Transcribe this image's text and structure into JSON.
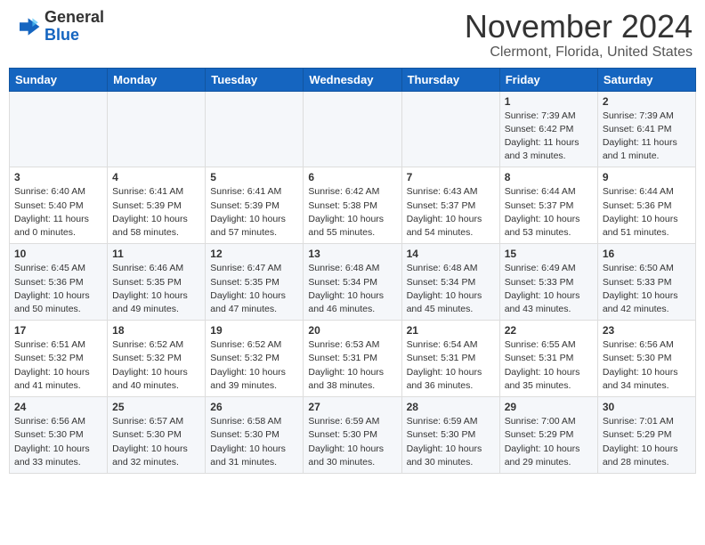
{
  "header": {
    "logo_line1": "General",
    "logo_line2": "Blue",
    "month": "November 2024",
    "location": "Clermont, Florida, United States"
  },
  "weekdays": [
    "Sunday",
    "Monday",
    "Tuesday",
    "Wednesday",
    "Thursday",
    "Friday",
    "Saturday"
  ],
  "weeks": [
    [
      {
        "day": "",
        "info": ""
      },
      {
        "day": "",
        "info": ""
      },
      {
        "day": "",
        "info": ""
      },
      {
        "day": "",
        "info": ""
      },
      {
        "day": "",
        "info": ""
      },
      {
        "day": "1",
        "info": "Sunrise: 7:39 AM\nSunset: 6:42 PM\nDaylight: 11 hours\nand 3 minutes."
      },
      {
        "day": "2",
        "info": "Sunrise: 7:39 AM\nSunset: 6:41 PM\nDaylight: 11 hours\nand 1 minute."
      }
    ],
    [
      {
        "day": "3",
        "info": "Sunrise: 6:40 AM\nSunset: 5:40 PM\nDaylight: 11 hours\nand 0 minutes."
      },
      {
        "day": "4",
        "info": "Sunrise: 6:41 AM\nSunset: 5:39 PM\nDaylight: 10 hours\nand 58 minutes."
      },
      {
        "day": "5",
        "info": "Sunrise: 6:41 AM\nSunset: 5:39 PM\nDaylight: 10 hours\nand 57 minutes."
      },
      {
        "day": "6",
        "info": "Sunrise: 6:42 AM\nSunset: 5:38 PM\nDaylight: 10 hours\nand 55 minutes."
      },
      {
        "day": "7",
        "info": "Sunrise: 6:43 AM\nSunset: 5:37 PM\nDaylight: 10 hours\nand 54 minutes."
      },
      {
        "day": "8",
        "info": "Sunrise: 6:44 AM\nSunset: 5:37 PM\nDaylight: 10 hours\nand 53 minutes."
      },
      {
        "day": "9",
        "info": "Sunrise: 6:44 AM\nSunset: 5:36 PM\nDaylight: 10 hours\nand 51 minutes."
      }
    ],
    [
      {
        "day": "10",
        "info": "Sunrise: 6:45 AM\nSunset: 5:36 PM\nDaylight: 10 hours\nand 50 minutes."
      },
      {
        "day": "11",
        "info": "Sunrise: 6:46 AM\nSunset: 5:35 PM\nDaylight: 10 hours\nand 49 minutes."
      },
      {
        "day": "12",
        "info": "Sunrise: 6:47 AM\nSunset: 5:35 PM\nDaylight: 10 hours\nand 47 minutes."
      },
      {
        "day": "13",
        "info": "Sunrise: 6:48 AM\nSunset: 5:34 PM\nDaylight: 10 hours\nand 46 minutes."
      },
      {
        "day": "14",
        "info": "Sunrise: 6:48 AM\nSunset: 5:34 PM\nDaylight: 10 hours\nand 45 minutes."
      },
      {
        "day": "15",
        "info": "Sunrise: 6:49 AM\nSunset: 5:33 PM\nDaylight: 10 hours\nand 43 minutes."
      },
      {
        "day": "16",
        "info": "Sunrise: 6:50 AM\nSunset: 5:33 PM\nDaylight: 10 hours\nand 42 minutes."
      }
    ],
    [
      {
        "day": "17",
        "info": "Sunrise: 6:51 AM\nSunset: 5:32 PM\nDaylight: 10 hours\nand 41 minutes."
      },
      {
        "day": "18",
        "info": "Sunrise: 6:52 AM\nSunset: 5:32 PM\nDaylight: 10 hours\nand 40 minutes."
      },
      {
        "day": "19",
        "info": "Sunrise: 6:52 AM\nSunset: 5:32 PM\nDaylight: 10 hours\nand 39 minutes."
      },
      {
        "day": "20",
        "info": "Sunrise: 6:53 AM\nSunset: 5:31 PM\nDaylight: 10 hours\nand 38 minutes."
      },
      {
        "day": "21",
        "info": "Sunrise: 6:54 AM\nSunset: 5:31 PM\nDaylight: 10 hours\nand 36 minutes."
      },
      {
        "day": "22",
        "info": "Sunrise: 6:55 AM\nSunset: 5:31 PM\nDaylight: 10 hours\nand 35 minutes."
      },
      {
        "day": "23",
        "info": "Sunrise: 6:56 AM\nSunset: 5:30 PM\nDaylight: 10 hours\nand 34 minutes."
      }
    ],
    [
      {
        "day": "24",
        "info": "Sunrise: 6:56 AM\nSunset: 5:30 PM\nDaylight: 10 hours\nand 33 minutes."
      },
      {
        "day": "25",
        "info": "Sunrise: 6:57 AM\nSunset: 5:30 PM\nDaylight: 10 hours\nand 32 minutes."
      },
      {
        "day": "26",
        "info": "Sunrise: 6:58 AM\nSunset: 5:30 PM\nDaylight: 10 hours\nand 31 minutes."
      },
      {
        "day": "27",
        "info": "Sunrise: 6:59 AM\nSunset: 5:30 PM\nDaylight: 10 hours\nand 30 minutes."
      },
      {
        "day": "28",
        "info": "Sunrise: 6:59 AM\nSunset: 5:30 PM\nDaylight: 10 hours\nand 30 minutes."
      },
      {
        "day": "29",
        "info": "Sunrise: 7:00 AM\nSunset: 5:29 PM\nDaylight: 10 hours\nand 29 minutes."
      },
      {
        "day": "30",
        "info": "Sunrise: 7:01 AM\nSunset: 5:29 PM\nDaylight: 10 hours\nand 28 minutes."
      }
    ]
  ]
}
